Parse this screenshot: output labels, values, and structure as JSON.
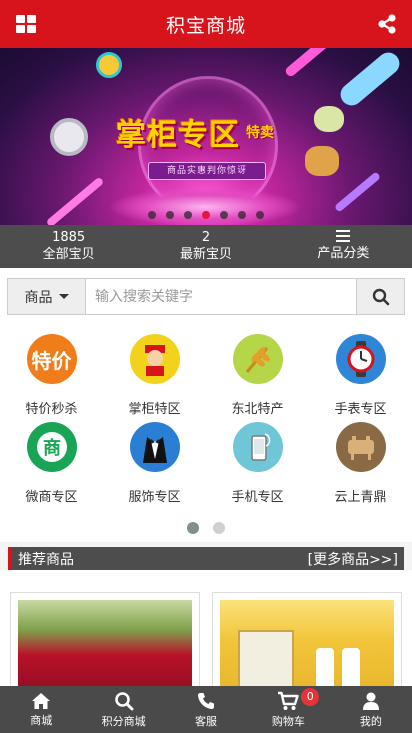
{
  "header": {
    "title": "积宝商城"
  },
  "banner": {
    "headline": "掌柜专区",
    "tag": "特卖",
    "ribbon": "商品实惠判你惊讶",
    "slide_count": 7,
    "active_slide": 3
  },
  "stats": [
    {
      "value": "1885",
      "label": "全部宝贝"
    },
    {
      "value": "2",
      "label": "最新宝贝"
    },
    {
      "value": "",
      "label": "产品分类",
      "icon": "list-icon"
    }
  ],
  "search": {
    "category": "商品",
    "placeholder": "输入搜索关键字"
  },
  "categories": [
    {
      "label": "特价秒杀",
      "icon": "price-tag-icon",
      "color": "#f07d1a"
    },
    {
      "label": "掌柜特区",
      "icon": "shopkeeper-icon",
      "color": "#f2d21b"
    },
    {
      "label": "东北特产",
      "icon": "wheat-icon",
      "color": "#b6d64a"
    },
    {
      "label": "手表专区",
      "icon": "clock-icon",
      "color": "#2f86d6"
    },
    {
      "label": "微商专区",
      "icon": "merchant-icon",
      "color": "#1aa556"
    },
    {
      "label": "服饰专区",
      "icon": "tuxedo-icon",
      "color": "#2a7fd4"
    },
    {
      "label": "手机专区",
      "icon": "phone-icon",
      "color": "#6fc6d6"
    },
    {
      "label": "云上青鼎",
      "icon": "bronze-ding-icon",
      "color": "#8a6a45"
    }
  ],
  "carousel": {
    "pages": 2,
    "active": 1
  },
  "recommend": {
    "title": "推荐商品",
    "more": "[更多商品>>]"
  },
  "nav": [
    {
      "label": "商城",
      "icon": "home-icon"
    },
    {
      "label": "积分商城",
      "icon": "search-icon"
    },
    {
      "label": "客服",
      "icon": "phone-icon"
    },
    {
      "label": "购物车",
      "icon": "cart-icon",
      "badge": "0"
    },
    {
      "label": "我的",
      "icon": "user-icon"
    }
  ],
  "colors": {
    "brand": "#d7141c",
    "bar": "#4d4d4d"
  }
}
